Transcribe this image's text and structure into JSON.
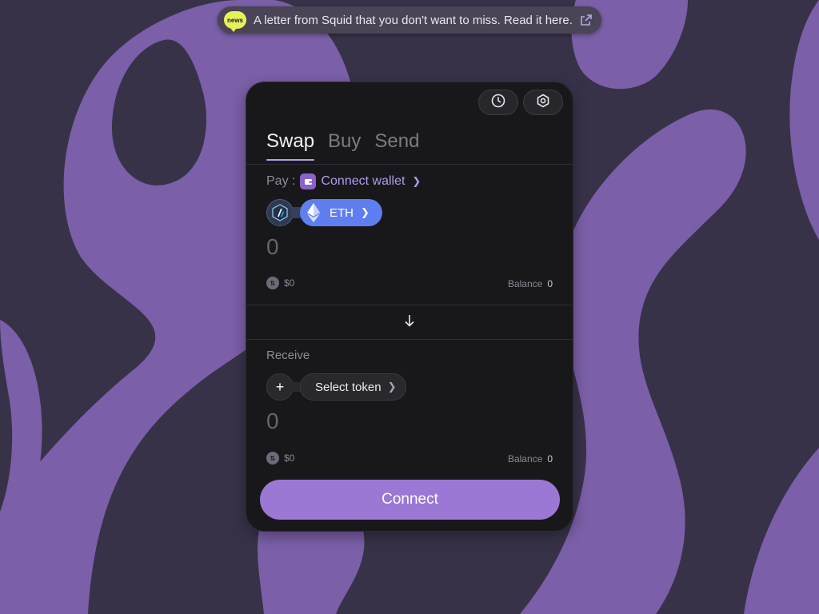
{
  "colors": {
    "background": "#383249",
    "blob": "#7b5fa8",
    "widget": "#18181b",
    "accent": "#9a78d4",
    "eth_pill": "#5f7ef0",
    "news_badge": "#e7f25a"
  },
  "banner": {
    "badge": "news",
    "text": "A letter from Squid that you don't want to miss. Read it here.",
    "icon": "external-link-icon"
  },
  "header": {
    "history_icon": "clock-icon",
    "settings_icon": "gear-icon"
  },
  "tabs": [
    {
      "label": "Swap",
      "active": true
    },
    {
      "label": "Buy",
      "active": false
    },
    {
      "label": "Send",
      "active": false
    }
  ],
  "pay": {
    "label": "Pay :",
    "wallet_link": "Connect wallet",
    "chain_icon": "arbitrum-icon",
    "token": "ETH",
    "token_icon": "ethereum-icon",
    "amount": "0",
    "usd_value": "$0",
    "balance_label": "Balance",
    "balance_value": "0"
  },
  "switch_icon": "arrow-down-icon",
  "receive": {
    "label": "Receive",
    "select_token": "Select token",
    "amount": "0",
    "usd_value": "$0",
    "balance_label": "Balance",
    "balance_value": "0"
  },
  "connect_button": "Connect"
}
